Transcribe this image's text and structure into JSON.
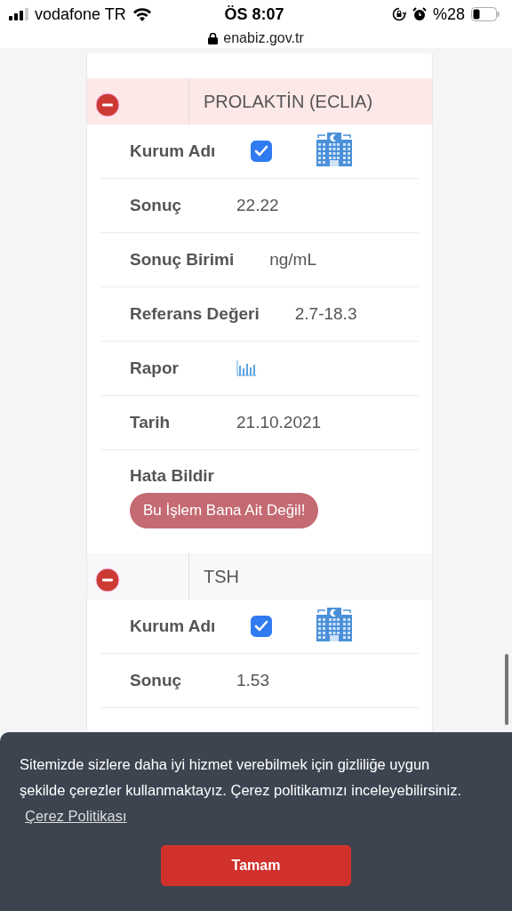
{
  "status_bar": {
    "carrier": "vodafone TR",
    "time": "ÖS 8:07",
    "battery": "%28",
    "url": "enabiz.gov.tr"
  },
  "sections": [
    {
      "title": "PROLAKTİN (ECLIA)",
      "expanded": true,
      "highlighted": true,
      "rows": [
        {
          "kind": "institution",
          "label": "Kurum Adı",
          "checked": true
        },
        {
          "kind": "text",
          "label": "Sonuç",
          "value": "22.22"
        },
        {
          "kind": "text",
          "label": "Sonuç Birimi",
          "value": "ng/mL"
        },
        {
          "kind": "text",
          "label": "Referans Değeri",
          "value": "2.7-18.3"
        },
        {
          "kind": "chart",
          "label": "Rapor"
        },
        {
          "kind": "text",
          "label": "Tarih",
          "value": "21.10.2021"
        },
        {
          "kind": "report",
          "label": "Hata Bildir",
          "button": "Bu İşlem Bana Ait Değil!"
        }
      ]
    },
    {
      "title": "TSH",
      "expanded": true,
      "highlighted": false,
      "rows": [
        {
          "kind": "institution",
          "label": "Kurum Adı",
          "checked": true
        },
        {
          "kind": "text",
          "label": "Sonuç",
          "value": "1.53"
        }
      ]
    }
  ],
  "cookie_banner": {
    "text": "Sitemizde sizlere daha iyi hizmet verebilmek için gizliliğe uygun şekilde çerezler kullanmaktayız. Çerez politikamızı inceleyebilirsiniz.",
    "link": "Çerez Politikası",
    "button": "Tamam"
  }
}
